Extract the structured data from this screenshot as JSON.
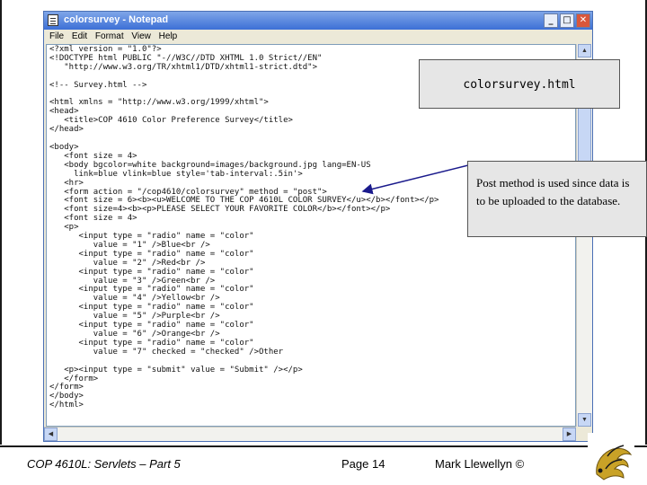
{
  "window": {
    "title": "colorsurvey - Notepad",
    "buttons": {
      "minimize": "_",
      "maximize": "□",
      "close": "✕"
    }
  },
  "menu": [
    "File",
    "Edit",
    "Format",
    "View",
    "Help"
  ],
  "code": "<?xml version = \"1.0\"?>\n<!DOCTYPE html PUBLIC \"-//W3C//DTD XHTML 1.0 Strict//EN\"\n   \"http://www.w3.org/TR/xhtml1/DTD/xhtml1-strict.dtd\">\n\n<!-- Survey.html -->\n\n<html xmlns = \"http://www.w3.org/1999/xhtml\">\n<head>\n   <title>COP 4610 Color Preference Survey</title>\n</head>\n\n<body>\n   <font size = 4>\n   <body bgcolor=white background=images/background.jpg lang=EN-US\n     link=blue vlink=blue style='tab-interval:.5in'>\n   <hr>\n   <form action = \"/cop4610/colorsurvey\" method = \"post\">\n   <font size = 6><b><u>WELCOME TO THE COP 4610L COLOR SURVEY</u></b></font></p>\n   <font size=4><b><p>PLEASE SELECT YOUR FAVORITE COLOR</b></font></p>\n   <font size = 4>\n   <p>\n      <input type = \"radio\" name = \"color\"\n         value = \"1\" />Blue<br />\n      <input type = \"radio\" name = \"color\"\n         value = \"2\" />Red<br />\n      <input type = \"radio\" name = \"color\"\n         value = \"3\" />Green<br />\n      <input type = \"radio\" name = \"color\"\n         value = \"4\" />Yellow<br />\n      <input type = \"radio\" name = \"color\"\n         value = \"5\" />Purple<br />\n      <input type = \"radio\" name = \"color\"\n         value = \"6\" />Orange<br />\n      <input type = \"radio\" name = \"color\"\n         value = \"7\" checked = \"checked\" />Other\n\n   <p><input type = \"submit\" value = \"Submit\" /></p>\n   </form>\n</form>\n</body>\n</html>",
  "callouts": {
    "filename": "colorsurvey.html",
    "note": "Post method is used since data is to be uploaded to the database."
  },
  "footer": {
    "course": "COP 4610L: Servlets – Part 5",
    "page": "Page 14",
    "author": "Mark Llewellyn ©"
  },
  "colors": {
    "titlebar": "#3c6fd6",
    "callout_bg": "#e6e6e6",
    "logo_gold": "#c9a227"
  },
  "icons": [
    "notepad-app-icon",
    "ucf-pegasus-logo"
  ]
}
